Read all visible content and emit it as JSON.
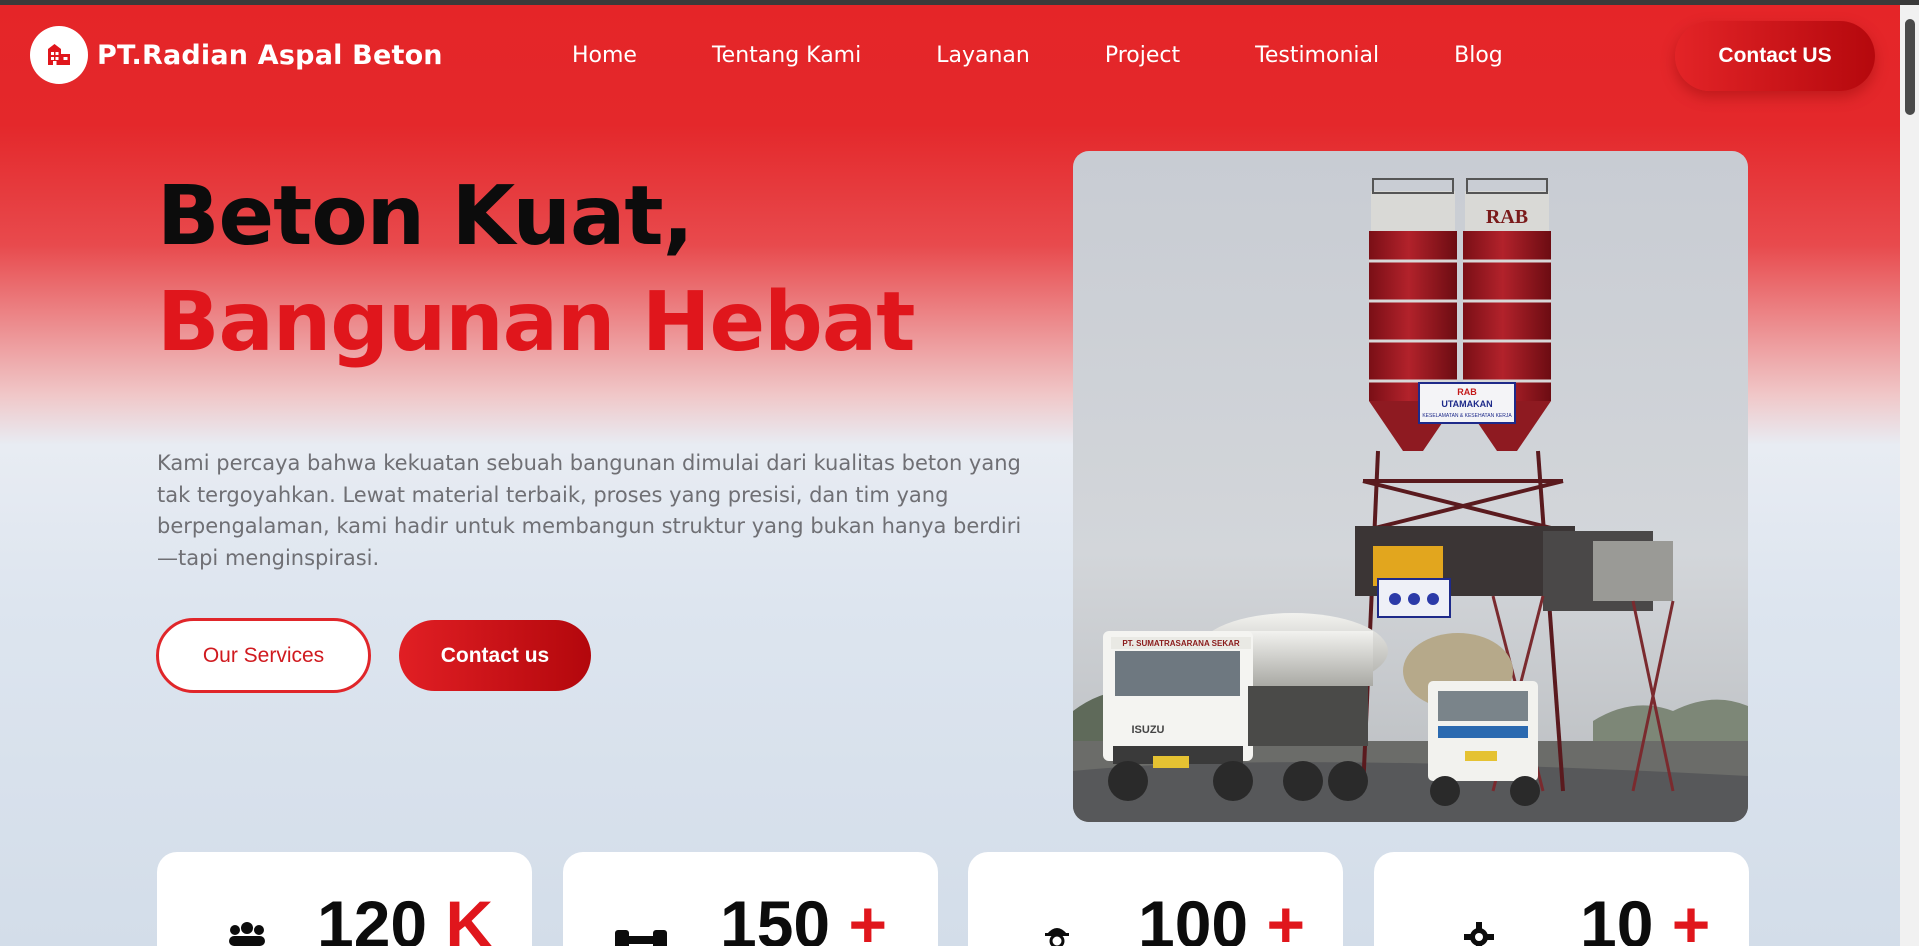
{
  "brand": {
    "name": "PT.Radian Aspal Beton",
    "logo_icon": "building-icon"
  },
  "nav": {
    "items": [
      "Home",
      "Tentang Kami",
      "Layanan",
      "Project",
      "Testimonial",
      "Blog"
    ],
    "contact_label": "Contact US"
  },
  "hero": {
    "title_line1": "Beton Kuat,",
    "title_line2": "Bangunan Hebat",
    "description": "Kami percaya bahwa kekuatan sebuah bangunan dimulai dari kualitas beton yang tak tergoyahkan. Lewat material terbaik, proses yang presisi, dan tim yang berpengalaman, kami hadir untuk membangun struktur yang bukan hanya berdiri—tapi menginspirasi.",
    "btn_services": "Our Services",
    "btn_contact": "Contact us",
    "photo_sign_brand": "RAB",
    "photo_sign_title": "UTAMAKAN",
    "photo_sign_sub": "KESELAMATAN & KESEHATAN KERJA",
    "photo_silo_label": "RAB",
    "photo_truck_label": "PT. SUMATRASARANA SEKAR",
    "photo_truck_brand": "ISUZU"
  },
  "stats": [
    {
      "value": "120",
      "suffix": "K",
      "icon": "people-icon"
    },
    {
      "value": "150",
      "suffix": "+",
      "icon": "tools-icon"
    },
    {
      "value": "100",
      "suffix": "+",
      "icon": "worker-icon"
    },
    {
      "value": "10",
      "suffix": "+",
      "icon": "gear-icon"
    }
  ],
  "colors": {
    "primary": "#e0161c",
    "dark_red": "#b3070c",
    "text_dark": "#0c0c0c",
    "text_muted": "#6f6f74"
  }
}
